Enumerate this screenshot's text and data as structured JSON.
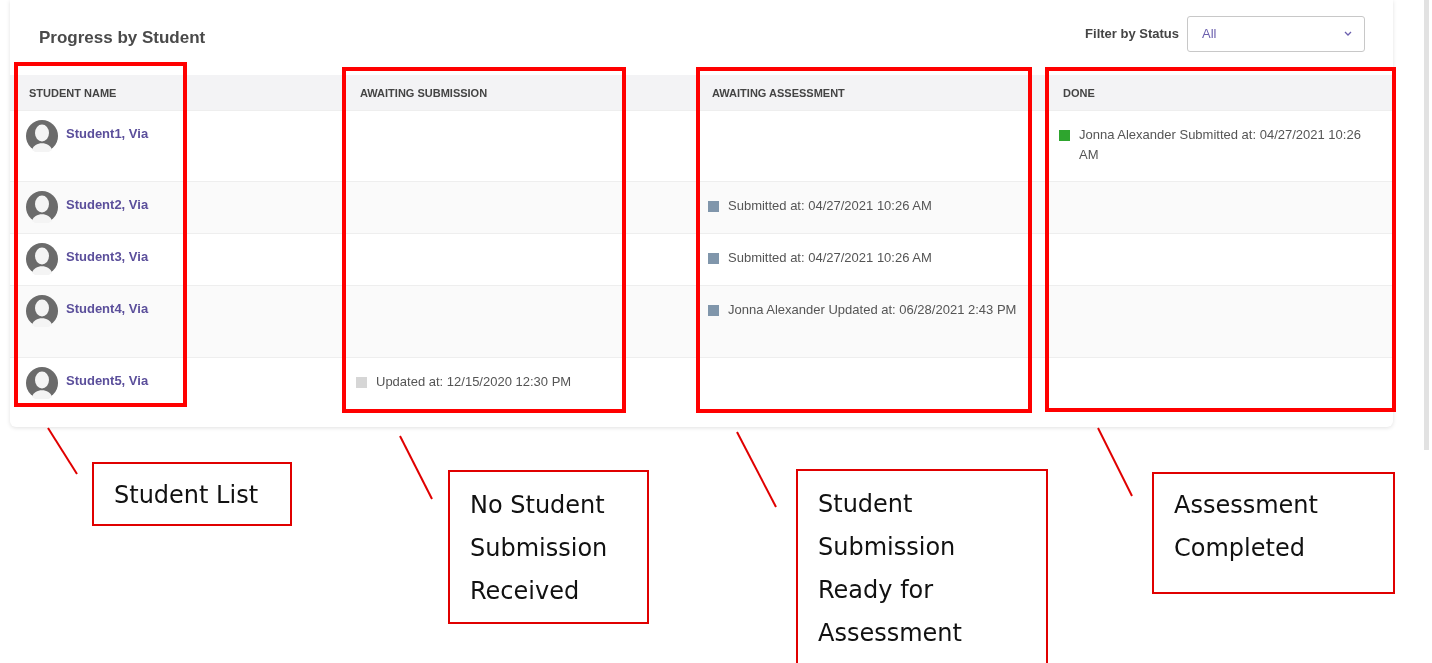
{
  "title": "Progress by Student",
  "filter": {
    "label": "Filter by Status",
    "value": "All"
  },
  "columns": [
    "STUDENT NAME",
    "AWAITING SUBMISSION",
    "AWAITING ASSESSMENT",
    "DONE"
  ],
  "rows": [
    {
      "name": "Student1, Via",
      "cells": [
        null,
        null,
        {
          "text": "Jonna Alexander Submitted at: 04/27/2021 10:26 AM",
          "color": "#2ea52e"
        }
      ]
    },
    {
      "name": "Student2, Via",
      "cells": [
        null,
        {
          "text": "Submitted at: 04/27/2021 10:26 AM",
          "color": "#8096ab"
        },
        null
      ]
    },
    {
      "name": "Student3, Via",
      "cells": [
        null,
        {
          "text": "Submitted at: 04/27/2021 10:26 AM",
          "color": "#8096ab"
        },
        null
      ]
    },
    {
      "name": "Student4, Via",
      "cells": [
        null,
        {
          "text": "Jonna Alexander Updated at: 06/28/2021 2:43 PM",
          "color": "#8096ab"
        },
        null
      ]
    },
    {
      "name": "Student5, Via",
      "cells": [
        {
          "text": "Updated at: 12/15/2020 12:30 PM",
          "color": "#d6d6d6"
        },
        null,
        null
      ]
    }
  ],
  "annotations": [
    {
      "label": "Student List"
    },
    {
      "label": "No Student Submission Received"
    },
    {
      "label": "Student Submission Ready for Assessment"
    },
    {
      "label": "Assessment Completed"
    }
  ]
}
